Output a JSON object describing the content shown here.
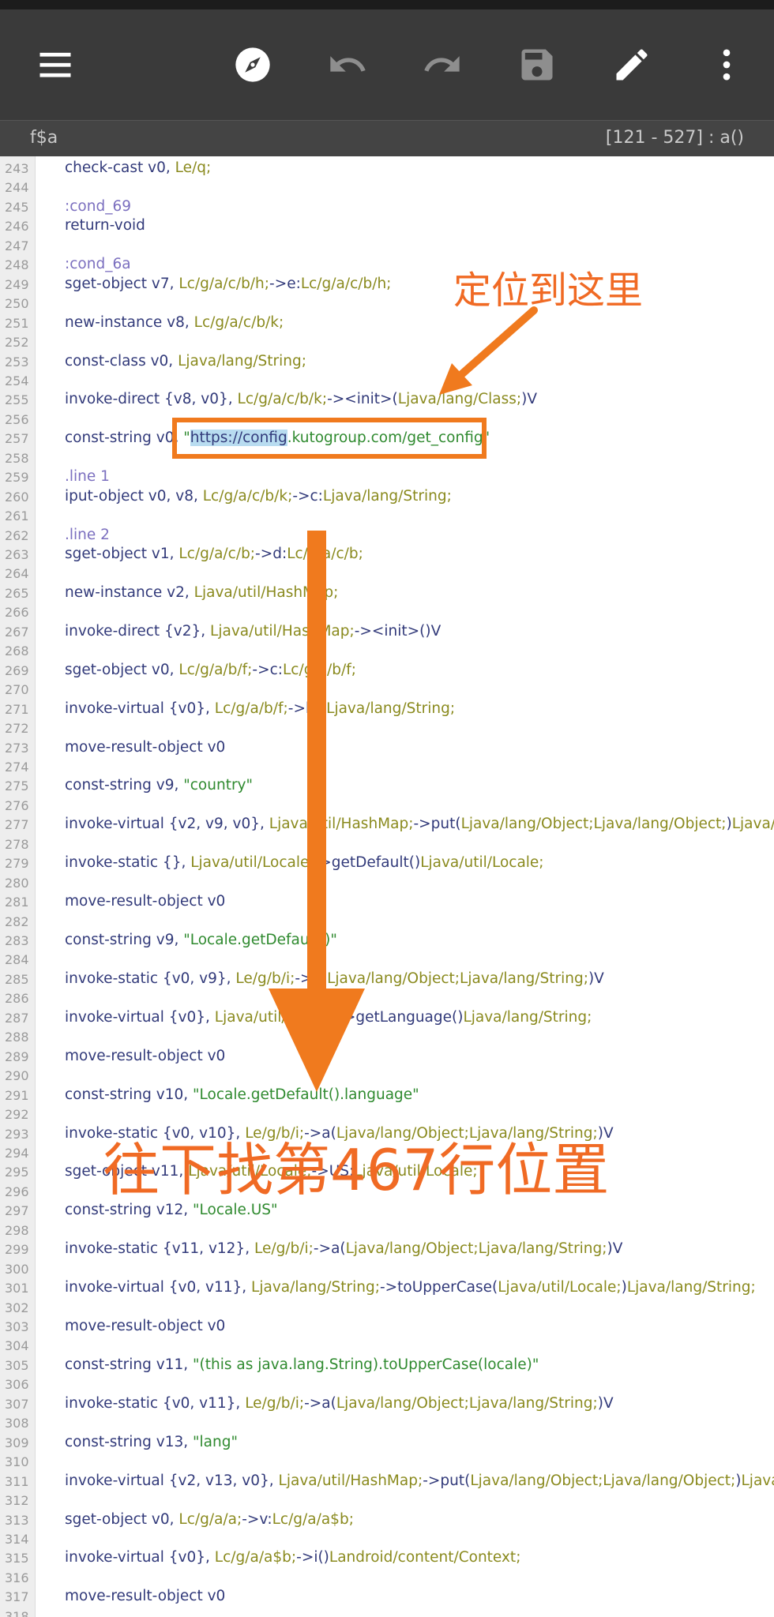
{
  "toolbar": {
    "icons": [
      "menu-icon",
      "compass-icon",
      "undo-icon",
      "redo-icon",
      "save-icon",
      "edit-icon",
      "more-vert-icon"
    ]
  },
  "file": {
    "name": "f$a",
    "range": "[121 - 527] : a()"
  },
  "code_lines": [
    {
      "n": "243",
      "parts": [
        [
          "c",
          "check-cast v0, "
        ],
        [
          "t",
          "Le/q;"
        ]
      ]
    },
    {
      "n": "244",
      "parts": []
    },
    {
      "n": "245",
      "parts": [
        [
          "l",
          ":cond_69"
        ]
      ]
    },
    {
      "n": "246",
      "parts": [
        [
          "c",
          "return-void"
        ]
      ]
    },
    {
      "n": "247",
      "parts": []
    },
    {
      "n": "248",
      "parts": [
        [
          "l",
          ":cond_6a"
        ]
      ]
    },
    {
      "n": "249",
      "parts": [
        [
          "c",
          "sget-object v7, "
        ],
        [
          "t",
          "Lc/g/a/c/b/h;"
        ],
        [
          "c",
          "->e:"
        ],
        [
          "t",
          "Lc/g/a/c/b/h;"
        ]
      ]
    },
    {
      "n": "250",
      "parts": []
    },
    {
      "n": "251",
      "parts": [
        [
          "c",
          "new-instance v8, "
        ],
        [
          "t",
          "Lc/g/a/c/b/k;"
        ]
      ]
    },
    {
      "n": "252",
      "parts": []
    },
    {
      "n": "253",
      "parts": [
        [
          "c",
          "const-class v0, "
        ],
        [
          "t",
          "Ljava/lang/String;"
        ]
      ]
    },
    {
      "n": "254",
      "parts": []
    },
    {
      "n": "255",
      "parts": [
        [
          "c",
          "invoke-direct {v8, v0}, "
        ],
        [
          "t",
          "Lc/g/a/c/b/k;"
        ],
        [
          "c",
          "-><init>("
        ],
        [
          "t",
          "Ljava/lang/Class;"
        ],
        [
          "c",
          ")V"
        ]
      ]
    },
    {
      "n": "256",
      "parts": []
    },
    {
      "n": "257",
      "parts": [
        [
          "c",
          "const-string v0, "
        ],
        [
          "s",
          "\""
        ],
        [
          "h",
          "https://config"
        ],
        [
          "s",
          ".kutogroup.com/get_config\""
        ]
      ]
    },
    {
      "n": "258",
      "parts": []
    },
    {
      "n": "259",
      "parts": [
        [
          "l",
          ".line 1"
        ]
      ]
    },
    {
      "n": "260",
      "parts": [
        [
          "c",
          "iput-object v0, v8, "
        ],
        [
          "t",
          "Lc/g/a/c/b/k;"
        ],
        [
          "c",
          "->c:"
        ],
        [
          "t",
          "Ljava/lang/String;"
        ]
      ]
    },
    {
      "n": "261",
      "parts": []
    },
    {
      "n": "262",
      "parts": [
        [
          "l",
          ".line 2"
        ]
      ]
    },
    {
      "n": "263",
      "parts": [
        [
          "c",
          "sget-object v1, "
        ],
        [
          "t",
          "Lc/g/a/c/b;"
        ],
        [
          "c",
          "->d:"
        ],
        [
          "t",
          "Lc/g/a/c/b;"
        ]
      ]
    },
    {
      "n": "264",
      "parts": []
    },
    {
      "n": "265",
      "parts": [
        [
          "c",
          "new-instance v2, "
        ],
        [
          "t",
          "Ljava/util/HashMap;"
        ]
      ]
    },
    {
      "n": "266",
      "parts": []
    },
    {
      "n": "267",
      "parts": [
        [
          "c",
          "invoke-direct {v2}, "
        ],
        [
          "t",
          "Ljava/util/HashMap;"
        ],
        [
          "c",
          "-><init>()V"
        ]
      ]
    },
    {
      "n": "268",
      "parts": []
    },
    {
      "n": "269",
      "parts": [
        [
          "c",
          "sget-object v0, "
        ],
        [
          "t",
          "Lc/g/a/b/f;"
        ],
        [
          "c",
          "->c:"
        ],
        [
          "t",
          "Lc/g/a/b/f;"
        ]
      ]
    },
    {
      "n": "270",
      "parts": []
    },
    {
      "n": "271",
      "parts": [
        [
          "c",
          "invoke-virtual {v0}, "
        ],
        [
          "t",
          "Lc/g/a/b/f;"
        ],
        [
          "c",
          "->b()"
        ],
        [
          "t",
          "Ljava/lang/String;"
        ]
      ]
    },
    {
      "n": "272",
      "parts": []
    },
    {
      "n": "273",
      "parts": [
        [
          "c",
          "move-result-object v0"
        ]
      ]
    },
    {
      "n": "274",
      "parts": []
    },
    {
      "n": "275",
      "parts": [
        [
          "c",
          "const-string v9, "
        ],
        [
          "s",
          "\"country\""
        ]
      ]
    },
    {
      "n": "276",
      "parts": []
    },
    {
      "n": "277",
      "parts": [
        [
          "c",
          "invoke-virtual {v2, v9, v0}, "
        ],
        [
          "t",
          "Ljava/util/HashMap;"
        ],
        [
          "c",
          "->put("
        ],
        [
          "t",
          "Ljava/lang/Object;Ljava/lang/Object;"
        ],
        [
          "c",
          ")"
        ],
        [
          "t",
          "Ljava/lang/Object;"
        ]
      ]
    },
    {
      "n": "278",
      "parts": []
    },
    {
      "n": "279",
      "parts": [
        [
          "c",
          "invoke-static {}, "
        ],
        [
          "t",
          "Ljava/util/Locale;"
        ],
        [
          "c",
          "->getDefault()"
        ],
        [
          "t",
          "Ljava/util/Locale;"
        ]
      ]
    },
    {
      "n": "280",
      "parts": []
    },
    {
      "n": "281",
      "parts": [
        [
          "c",
          "move-result-object v0"
        ]
      ]
    },
    {
      "n": "282",
      "parts": []
    },
    {
      "n": "283",
      "parts": [
        [
          "c",
          "const-string v9, "
        ],
        [
          "s",
          "\"Locale.getDefault()\""
        ]
      ]
    },
    {
      "n": "284",
      "parts": []
    },
    {
      "n": "285",
      "parts": [
        [
          "c",
          "invoke-static {v0, v9}, "
        ],
        [
          "t",
          "Le/g/b/i;"
        ],
        [
          "c",
          "->a("
        ],
        [
          "t",
          "Ljava/lang/Object;Ljava/lang/String;"
        ],
        [
          "c",
          ")V"
        ]
      ]
    },
    {
      "n": "286",
      "parts": []
    },
    {
      "n": "287",
      "parts": [
        [
          "c",
          "invoke-virtual {v0}, "
        ],
        [
          "t",
          "Ljava/util/Locale;"
        ],
        [
          "c",
          "->getLanguage()"
        ],
        [
          "t",
          "Ljava/lang/String;"
        ]
      ]
    },
    {
      "n": "288",
      "parts": []
    },
    {
      "n": "289",
      "parts": [
        [
          "c",
          "move-result-object v0"
        ]
      ]
    },
    {
      "n": "290",
      "parts": []
    },
    {
      "n": "291",
      "parts": [
        [
          "c",
          "const-string v10, "
        ],
        [
          "s",
          "\"Locale.getDefault().language\""
        ]
      ]
    },
    {
      "n": "292",
      "parts": []
    },
    {
      "n": "293",
      "parts": [
        [
          "c",
          "invoke-static {v0, v10}, "
        ],
        [
          "t",
          "Le/g/b/i;"
        ],
        [
          "c",
          "->a("
        ],
        [
          "t",
          "Ljava/lang/Object;Ljava/lang/String;"
        ],
        [
          "c",
          ")V"
        ]
      ]
    },
    {
      "n": "294",
      "parts": []
    },
    {
      "n": "295",
      "parts": [
        [
          "c",
          "sget-object v11, "
        ],
        [
          "t",
          "Ljava/util/Locale;"
        ],
        [
          "c",
          "->US:"
        ],
        [
          "t",
          "Ljava/util/Locale;"
        ]
      ]
    },
    {
      "n": "296",
      "parts": []
    },
    {
      "n": "297",
      "parts": [
        [
          "c",
          "const-string v12, "
        ],
        [
          "s",
          "\"Locale.US\""
        ]
      ]
    },
    {
      "n": "298",
      "parts": []
    },
    {
      "n": "299",
      "parts": [
        [
          "c",
          "invoke-static {v11, v12}, "
        ],
        [
          "t",
          "Le/g/b/i;"
        ],
        [
          "c",
          "->a("
        ],
        [
          "t",
          "Ljava/lang/Object;Ljava/lang/String;"
        ],
        [
          "c",
          ")V"
        ]
      ]
    },
    {
      "n": "300",
      "parts": []
    },
    {
      "n": "301",
      "parts": [
        [
          "c",
          "invoke-virtual {v0, v11}, "
        ],
        [
          "t",
          "Ljava/lang/String;"
        ],
        [
          "c",
          "->toUpperCase("
        ],
        [
          "t",
          "Ljava/util/Locale;"
        ],
        [
          "c",
          ")"
        ],
        [
          "t",
          "Ljava/lang/String;"
        ]
      ]
    },
    {
      "n": "302",
      "parts": []
    },
    {
      "n": "303",
      "parts": [
        [
          "c",
          "move-result-object v0"
        ]
      ]
    },
    {
      "n": "304",
      "parts": []
    },
    {
      "n": "305",
      "parts": [
        [
          "c",
          "const-string v11, "
        ],
        [
          "s",
          "\"(this as java.lang.String).toUpperCase(locale)\""
        ]
      ]
    },
    {
      "n": "306",
      "parts": []
    },
    {
      "n": "307",
      "parts": [
        [
          "c",
          "invoke-static {v0, v11}, "
        ],
        [
          "t",
          "Le/g/b/i;"
        ],
        [
          "c",
          "->a("
        ],
        [
          "t",
          "Ljava/lang/Object;Ljava/lang/String;"
        ],
        [
          "c",
          ")V"
        ]
      ]
    },
    {
      "n": "308",
      "parts": []
    },
    {
      "n": "309",
      "parts": [
        [
          "c",
          "const-string v13, "
        ],
        [
          "s",
          "\"lang\""
        ]
      ]
    },
    {
      "n": "310",
      "parts": []
    },
    {
      "n": "311",
      "parts": [
        [
          "c",
          "invoke-virtual {v2, v13, v0}, "
        ],
        [
          "t",
          "Ljava/util/HashMap;"
        ],
        [
          "c",
          "->put("
        ],
        [
          "t",
          "Ljava/lang/Object;Ljava/lang/Object;"
        ],
        [
          "c",
          ")"
        ],
        [
          "t",
          "Ljava/lang/Object;"
        ]
      ]
    },
    {
      "n": "312",
      "parts": []
    },
    {
      "n": "313",
      "parts": [
        [
          "c",
          "sget-object v0, "
        ],
        [
          "t",
          "Lc/g/a/a;"
        ],
        [
          "c",
          "->v:"
        ],
        [
          "t",
          "Lc/g/a/a$b;"
        ]
      ]
    },
    {
      "n": "314",
      "parts": []
    },
    {
      "n": "315",
      "parts": [
        [
          "c",
          "invoke-virtual {v0}, "
        ],
        [
          "t",
          "Lc/g/a/a$b;"
        ],
        [
          "c",
          "->i()"
        ],
        [
          "t",
          "Landroid/content/Context;"
        ]
      ]
    },
    {
      "n": "316",
      "parts": []
    },
    {
      "n": "317",
      "parts": [
        [
          "c",
          "move-result-object v0"
        ]
      ]
    },
    {
      "n": "318",
      "parts": []
    }
  ],
  "annotations": {
    "locate_here": "定位到这里",
    "go_to_line": "往下找第467行位置",
    "accent_color": "#f07a1e"
  }
}
